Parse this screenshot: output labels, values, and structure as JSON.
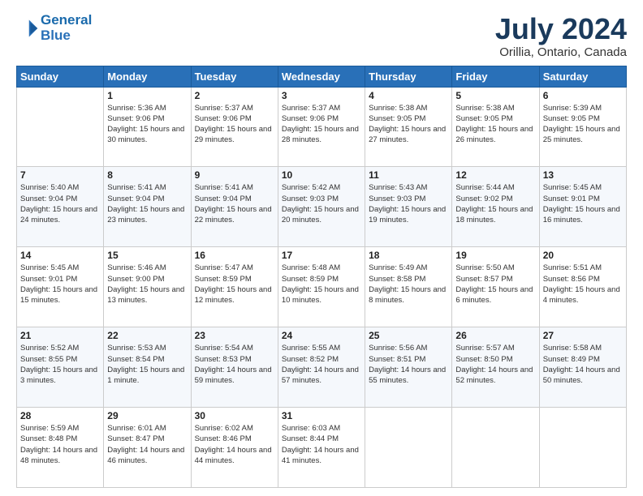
{
  "header": {
    "logo_line1": "General",
    "logo_line2": "Blue",
    "title": "July 2024",
    "subtitle": "Orillia, Ontario, Canada"
  },
  "weekdays": [
    "Sunday",
    "Monday",
    "Tuesday",
    "Wednesday",
    "Thursday",
    "Friday",
    "Saturday"
  ],
  "weeks": [
    [
      {
        "num": "",
        "sunrise": "",
        "sunset": "",
        "daylight": ""
      },
      {
        "num": "1",
        "sunrise": "Sunrise: 5:36 AM",
        "sunset": "Sunset: 9:06 PM",
        "daylight": "Daylight: 15 hours and 30 minutes."
      },
      {
        "num": "2",
        "sunrise": "Sunrise: 5:37 AM",
        "sunset": "Sunset: 9:06 PM",
        "daylight": "Daylight: 15 hours and 29 minutes."
      },
      {
        "num": "3",
        "sunrise": "Sunrise: 5:37 AM",
        "sunset": "Sunset: 9:06 PM",
        "daylight": "Daylight: 15 hours and 28 minutes."
      },
      {
        "num": "4",
        "sunrise": "Sunrise: 5:38 AM",
        "sunset": "Sunset: 9:05 PM",
        "daylight": "Daylight: 15 hours and 27 minutes."
      },
      {
        "num": "5",
        "sunrise": "Sunrise: 5:38 AM",
        "sunset": "Sunset: 9:05 PM",
        "daylight": "Daylight: 15 hours and 26 minutes."
      },
      {
        "num": "6",
        "sunrise": "Sunrise: 5:39 AM",
        "sunset": "Sunset: 9:05 PM",
        "daylight": "Daylight: 15 hours and 25 minutes."
      }
    ],
    [
      {
        "num": "7",
        "sunrise": "Sunrise: 5:40 AM",
        "sunset": "Sunset: 9:04 PM",
        "daylight": "Daylight: 15 hours and 24 minutes."
      },
      {
        "num": "8",
        "sunrise": "Sunrise: 5:41 AM",
        "sunset": "Sunset: 9:04 PM",
        "daylight": "Daylight: 15 hours and 23 minutes."
      },
      {
        "num": "9",
        "sunrise": "Sunrise: 5:41 AM",
        "sunset": "Sunset: 9:04 PM",
        "daylight": "Daylight: 15 hours and 22 minutes."
      },
      {
        "num": "10",
        "sunrise": "Sunrise: 5:42 AM",
        "sunset": "Sunset: 9:03 PM",
        "daylight": "Daylight: 15 hours and 20 minutes."
      },
      {
        "num": "11",
        "sunrise": "Sunrise: 5:43 AM",
        "sunset": "Sunset: 9:03 PM",
        "daylight": "Daylight: 15 hours and 19 minutes."
      },
      {
        "num": "12",
        "sunrise": "Sunrise: 5:44 AM",
        "sunset": "Sunset: 9:02 PM",
        "daylight": "Daylight: 15 hours and 18 minutes."
      },
      {
        "num": "13",
        "sunrise": "Sunrise: 5:45 AM",
        "sunset": "Sunset: 9:01 PM",
        "daylight": "Daylight: 15 hours and 16 minutes."
      }
    ],
    [
      {
        "num": "14",
        "sunrise": "Sunrise: 5:45 AM",
        "sunset": "Sunset: 9:01 PM",
        "daylight": "Daylight: 15 hours and 15 minutes."
      },
      {
        "num": "15",
        "sunrise": "Sunrise: 5:46 AM",
        "sunset": "Sunset: 9:00 PM",
        "daylight": "Daylight: 15 hours and 13 minutes."
      },
      {
        "num": "16",
        "sunrise": "Sunrise: 5:47 AM",
        "sunset": "Sunset: 8:59 PM",
        "daylight": "Daylight: 15 hours and 12 minutes."
      },
      {
        "num": "17",
        "sunrise": "Sunrise: 5:48 AM",
        "sunset": "Sunset: 8:59 PM",
        "daylight": "Daylight: 15 hours and 10 minutes."
      },
      {
        "num": "18",
        "sunrise": "Sunrise: 5:49 AM",
        "sunset": "Sunset: 8:58 PM",
        "daylight": "Daylight: 15 hours and 8 minutes."
      },
      {
        "num": "19",
        "sunrise": "Sunrise: 5:50 AM",
        "sunset": "Sunset: 8:57 PM",
        "daylight": "Daylight: 15 hours and 6 minutes."
      },
      {
        "num": "20",
        "sunrise": "Sunrise: 5:51 AM",
        "sunset": "Sunset: 8:56 PM",
        "daylight": "Daylight: 15 hours and 4 minutes."
      }
    ],
    [
      {
        "num": "21",
        "sunrise": "Sunrise: 5:52 AM",
        "sunset": "Sunset: 8:55 PM",
        "daylight": "Daylight: 15 hours and 3 minutes."
      },
      {
        "num": "22",
        "sunrise": "Sunrise: 5:53 AM",
        "sunset": "Sunset: 8:54 PM",
        "daylight": "Daylight: 15 hours and 1 minute."
      },
      {
        "num": "23",
        "sunrise": "Sunrise: 5:54 AM",
        "sunset": "Sunset: 8:53 PM",
        "daylight": "Daylight: 14 hours and 59 minutes."
      },
      {
        "num": "24",
        "sunrise": "Sunrise: 5:55 AM",
        "sunset": "Sunset: 8:52 PM",
        "daylight": "Daylight: 14 hours and 57 minutes."
      },
      {
        "num": "25",
        "sunrise": "Sunrise: 5:56 AM",
        "sunset": "Sunset: 8:51 PM",
        "daylight": "Daylight: 14 hours and 55 minutes."
      },
      {
        "num": "26",
        "sunrise": "Sunrise: 5:57 AM",
        "sunset": "Sunset: 8:50 PM",
        "daylight": "Daylight: 14 hours and 52 minutes."
      },
      {
        "num": "27",
        "sunrise": "Sunrise: 5:58 AM",
        "sunset": "Sunset: 8:49 PM",
        "daylight": "Daylight: 14 hours and 50 minutes."
      }
    ],
    [
      {
        "num": "28",
        "sunrise": "Sunrise: 5:59 AM",
        "sunset": "Sunset: 8:48 PM",
        "daylight": "Daylight: 14 hours and 48 minutes."
      },
      {
        "num": "29",
        "sunrise": "Sunrise: 6:01 AM",
        "sunset": "Sunset: 8:47 PM",
        "daylight": "Daylight: 14 hours and 46 minutes."
      },
      {
        "num": "30",
        "sunrise": "Sunrise: 6:02 AM",
        "sunset": "Sunset: 8:46 PM",
        "daylight": "Daylight: 14 hours and 44 minutes."
      },
      {
        "num": "31",
        "sunrise": "Sunrise: 6:03 AM",
        "sunset": "Sunset: 8:44 PM",
        "daylight": "Daylight: 14 hours and 41 minutes."
      },
      {
        "num": "",
        "sunrise": "",
        "sunset": "",
        "daylight": ""
      },
      {
        "num": "",
        "sunrise": "",
        "sunset": "",
        "daylight": ""
      },
      {
        "num": "",
        "sunrise": "",
        "sunset": "",
        "daylight": ""
      }
    ]
  ]
}
